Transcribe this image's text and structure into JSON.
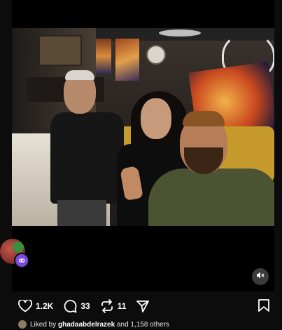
{
  "post": {
    "media_icons": {
      "mute": "speaker-muted-icon",
      "collab": "collab-icon"
    },
    "actions": {
      "like": {
        "icon": "heart-icon",
        "count": "1.2K"
      },
      "comment": {
        "icon": "comment-icon",
        "count": "33"
      },
      "repost": {
        "icon": "repost-icon",
        "count": "11"
      },
      "share": {
        "icon": "send-icon"
      },
      "save": {
        "icon": "bookmark-icon"
      }
    },
    "liked_by": {
      "prefix": "Liked by ",
      "user": "ghadaabdelrazek",
      "suffix": " and 1,158 others"
    }
  },
  "colors": {
    "background": "#0c0c0c",
    "text": "#ffffff",
    "collab_badge": "#7a4dd8"
  }
}
